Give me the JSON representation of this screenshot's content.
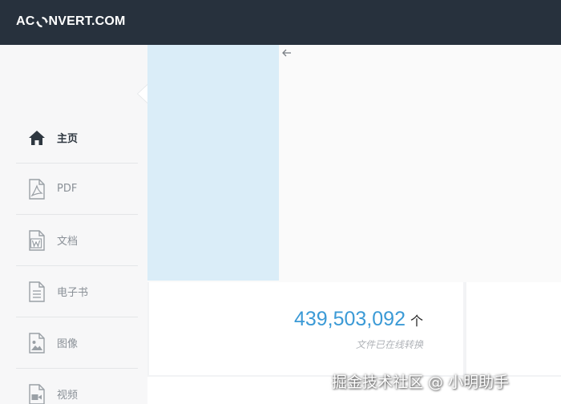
{
  "header": {
    "logo_left": "AC",
    "logo_icon": "refresh-ring-icon",
    "logo_right": "NVERT.COM"
  },
  "sidebar": {
    "items": [
      {
        "label": "主页",
        "icon": "home-icon",
        "active": true
      },
      {
        "label": "PDF",
        "icon": "pdf-file-icon",
        "active": false
      },
      {
        "label": "文档",
        "icon": "word-file-icon",
        "active": false
      },
      {
        "label": "电子书",
        "icon": "ebook-file-icon",
        "active": false
      },
      {
        "label": "图像",
        "icon": "image-file-icon",
        "active": false
      },
      {
        "label": "视频",
        "icon": "video-file-icon",
        "active": false
      }
    ]
  },
  "stats": {
    "count": "439,503,092",
    "unit": "个",
    "caption": "文件已在线转换"
  },
  "watermark": "掘金技术社区 @ 小明助手",
  "colors": {
    "topbar": "#27313d",
    "accent": "#3b9ad6",
    "banner": "#daedf8"
  }
}
